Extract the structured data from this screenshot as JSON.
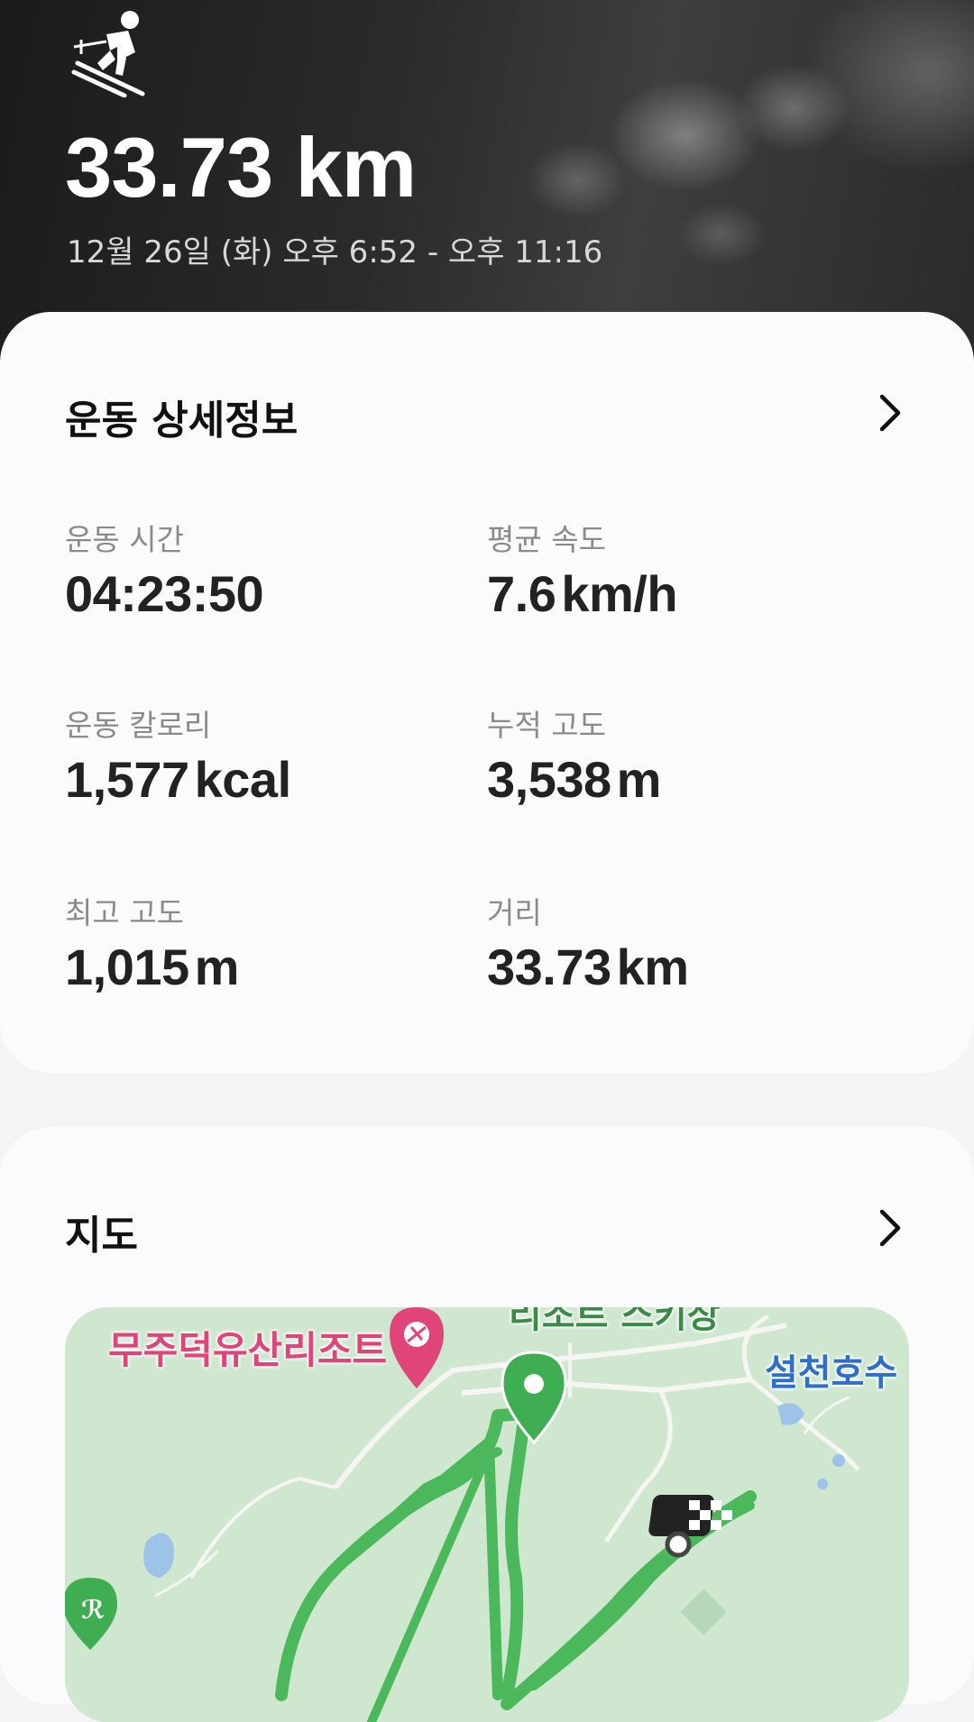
{
  "hero": {
    "activity_icon": "skiing-icon",
    "distance": "33.73 km",
    "date_range": "12월 26일 (화) 오후 6:52 - 오후 11:16"
  },
  "details": {
    "title": "운동 상세정보",
    "chevron_icon": "chevron-right-icon",
    "stats": [
      {
        "label": "운동 시간",
        "value": "04:23:50",
        "unit": ""
      },
      {
        "label": "평균 속도",
        "value": "7.6",
        "unit": "km/h"
      },
      {
        "label": "운동 칼로리",
        "value": "1,577",
        "unit": "kcal"
      },
      {
        "label": "누적 고도",
        "value": "3,538",
        "unit": "m"
      },
      {
        "label": "최고 고도",
        "value": "1,015",
        "unit": "m"
      },
      {
        "label": "거리",
        "value": "33.73",
        "unit": "km"
      }
    ]
  },
  "map": {
    "title": "지도",
    "chevron_icon": "chevron-right-icon",
    "labels": {
      "resort": "무주덕유산리조트",
      "ski_area": "리조트 스키장",
      "lake": "설천호수"
    },
    "colors": {
      "route": "#4cb85c",
      "resort_label": "#e0457a",
      "lake_label": "#2f6fc9",
      "pin": "#3fae52"
    }
  }
}
